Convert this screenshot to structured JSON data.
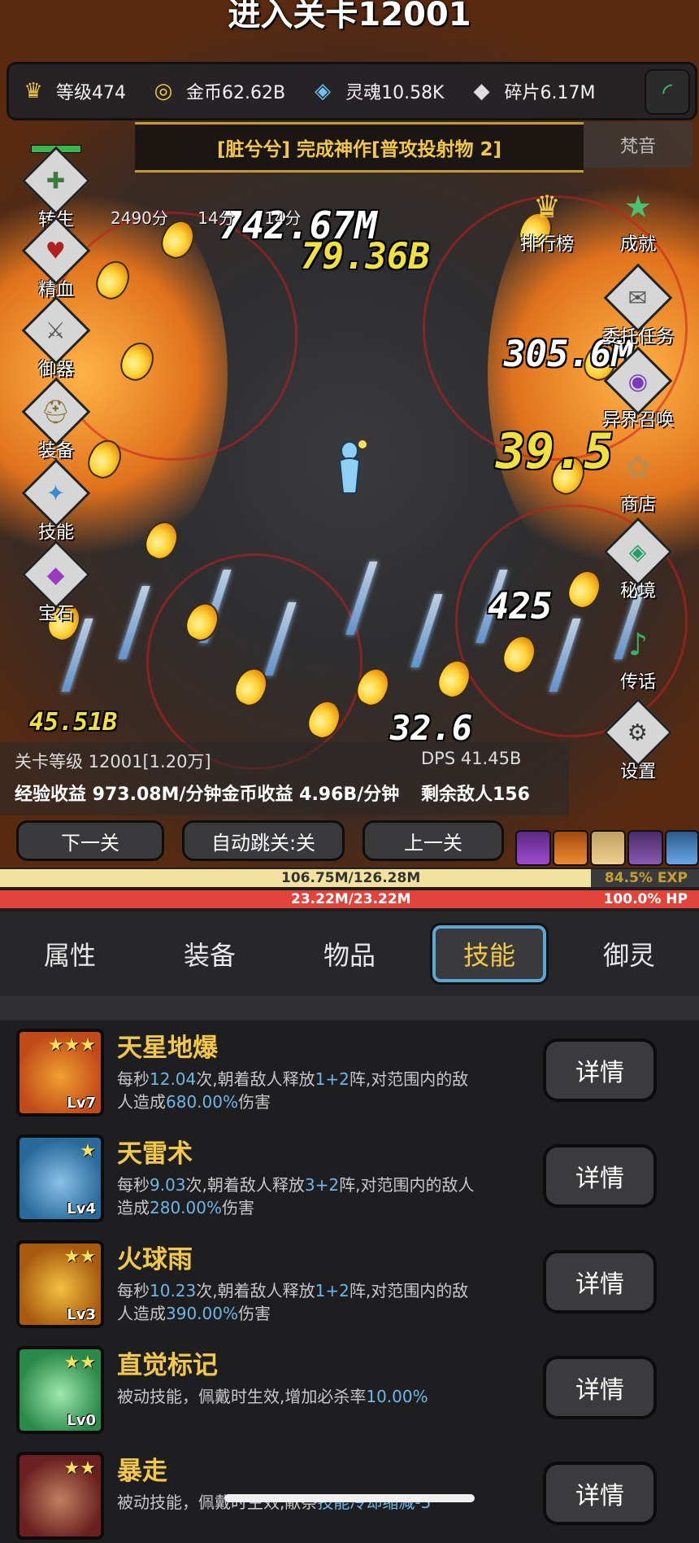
{
  "stage_title": "进入关卡12001",
  "resources": [
    {
      "icon": "crown-icon",
      "glyph": "♛",
      "label": "等级474",
      "color": "#f2c84a"
    },
    {
      "icon": "coin-icon",
      "glyph": "◎",
      "label": "金币62.62B",
      "color": "#f2c84a"
    },
    {
      "icon": "soul-icon",
      "glyph": "◈",
      "label": "灵魂10.58K",
      "color": "#6fc3f0"
    },
    {
      "icon": "shard-icon",
      "glyph": "◆",
      "label": "碎片6.17M",
      "color": "#dddddd"
    }
  ],
  "announcement": "[脏兮兮] 完成神作[普攻投射物 2]",
  "announcement_side": "梵音",
  "scores": [
    "2490分",
    "14分",
    "14分"
  ],
  "left_menu": [
    {
      "label": "转生",
      "glyph": "✚"
    },
    {
      "label": "精血",
      "glyph": "♥"
    },
    {
      "label": "御器",
      "glyph": "⚔"
    },
    {
      "label": "装备",
      "glyph": "⛑"
    },
    {
      "label": "技能",
      "glyph": "✦"
    },
    {
      "label": "宝石",
      "glyph": "◆"
    }
  ],
  "right_menu": [
    {
      "label": "排行榜",
      "glyph": "♛"
    },
    {
      "label": "成就",
      "glyph": "★"
    },
    {
      "label": "委托任务",
      "glyph": "✉"
    },
    {
      "label": "异界召唤",
      "glyph": "◉"
    },
    {
      "label": "商店",
      "glyph": "✿"
    },
    {
      "label": "秘境",
      "glyph": "◈"
    },
    {
      "label": "传话",
      "glyph": "♪"
    },
    {
      "label": "设置",
      "glyph": "⚙"
    }
  ],
  "damage_numbers": [
    "742.67M",
    "79.36B",
    "305.6M",
    "39.5",
    "425",
    "45.51B",
    "32.6"
  ],
  "info": {
    "stage_level": "关卡等级 12001[1.20万]",
    "dps": "DPS 41.45B",
    "income": "经验收益 973.08M/分钟金币收益 4.96B/分钟",
    "enemies": "剩余敌人156"
  },
  "nav": {
    "next": "下一关",
    "auto": "自动跳关:关",
    "prev": "上一关"
  },
  "exp_bar": {
    "text": "106.75M/126.28M",
    "percent_text": "84.5% EXP",
    "fraction": 0.845
  },
  "hp_bar": {
    "text": "23.22M/23.22M",
    "percent_text": "100.0%  HP",
    "fraction": 1.0
  },
  "tabs": [
    "属性",
    "装备",
    "物品",
    "技能",
    "御灵"
  ],
  "active_tab": "技能",
  "skills": [
    {
      "name": "天星地爆",
      "stars": "★★★",
      "level": "Lv7",
      "color1": "#c24a1a",
      "color2": "#f0a030",
      "desc": [
        {
          "t": "每秒"
        },
        {
          "t": "12.04",
          "h": true
        },
        {
          "t": "次,朝着敌人释放"
        },
        {
          "t": "1+2",
          "h": true
        },
        {
          "t": "阵,对范围内的敌人造成"
        },
        {
          "t": "680.00%",
          "h": true
        },
        {
          "t": "伤害"
        }
      ]
    },
    {
      "name": "天雷术",
      "stars": "★",
      "level": "Lv4",
      "color1": "#2a6a9a",
      "color2": "#8ac0e8",
      "desc": [
        {
          "t": "每秒"
        },
        {
          "t": "9.03",
          "h": true
        },
        {
          "t": "次,朝着敌人释放"
        },
        {
          "t": "3+2",
          "h": true
        },
        {
          "t": "阵,对范围内的敌人造成"
        },
        {
          "t": "280.00%",
          "h": true
        },
        {
          "t": "伤害"
        }
      ]
    },
    {
      "name": "火球雨",
      "stars": "★★",
      "level": "Lv3",
      "color1": "#a85a10",
      "color2": "#f5c040",
      "desc": [
        {
          "t": "每秒"
        },
        {
          "t": "10.23",
          "h": true
        },
        {
          "t": "次,朝着敌人释放"
        },
        {
          "t": "1+2",
          "h": true
        },
        {
          "t": "阵,对范围内的敌人造成"
        },
        {
          "t": "390.00%",
          "h": true
        },
        {
          "t": "伤害"
        }
      ]
    },
    {
      "name": "直觉标记",
      "stars": "★★",
      "level": "Lv0",
      "color1": "#2a8a4a",
      "color2": "#a0e8b0",
      "desc": [
        {
          "t": "被动技能，佩戴时生效,增加必杀率"
        },
        {
          "t": "10.00%",
          "h": true
        }
      ]
    },
    {
      "name": "暴走",
      "stars": "★★",
      "level": "",
      "color1": "#6a2020",
      "color2": "#c08060",
      "desc": [
        {
          "t": "被动技能，佩戴时生效,献祭"
        },
        {
          "t": "技能冷却缩减-5",
          "h": true
        }
      ]
    }
  ],
  "detail_label": "详情"
}
